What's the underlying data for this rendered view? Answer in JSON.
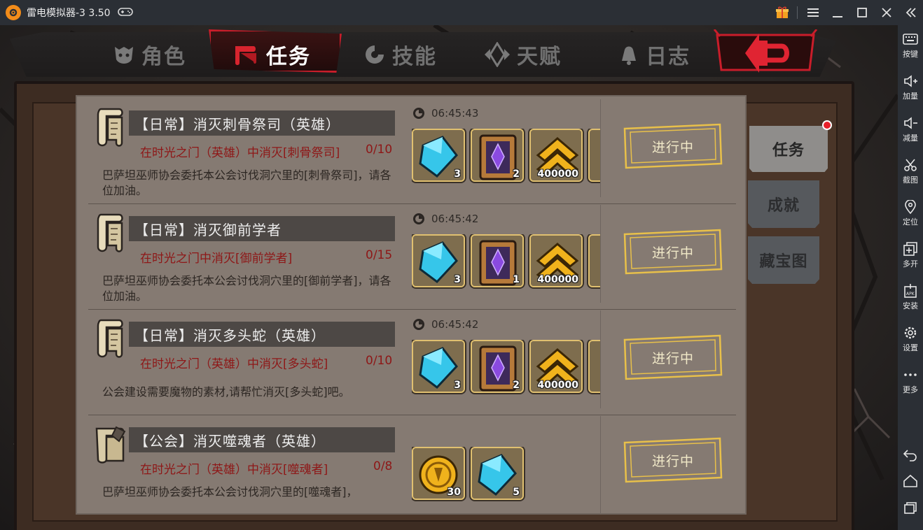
{
  "window": {
    "title": "雷电模拟器-3 3.50"
  },
  "sidebar": {
    "items": [
      {
        "label": "按键",
        "icon": "keyboard-icon"
      },
      {
        "label": "加量",
        "icon": "volume-up-icon"
      },
      {
        "label": "减量",
        "icon": "volume-down-icon"
      },
      {
        "label": "截图",
        "icon": "scissors-icon"
      },
      {
        "label": "定位",
        "icon": "location-pin-icon"
      },
      {
        "label": "多开",
        "icon": "multi-instance-icon"
      },
      {
        "label": "安装",
        "icon": "apk-install-icon"
      },
      {
        "label": "设置",
        "icon": "gear-icon"
      },
      {
        "label": "更多",
        "icon": "more-dots-icon"
      }
    ]
  },
  "tabs": [
    {
      "label": "角色",
      "icon": "character-mask-icon",
      "active": false
    },
    {
      "label": "任务",
      "icon": "quest-scroll-icon",
      "active": true
    },
    {
      "label": "技能",
      "icon": "skill-swirl-icon",
      "active": false
    },
    {
      "label": "天赋",
      "icon": "talent-crystal-icon",
      "active": false
    },
    {
      "label": "日志",
      "icon": "log-bell-icon",
      "active": false
    }
  ],
  "side_tabs": [
    {
      "label": "任务",
      "active": true
    },
    {
      "label": "成就",
      "active": false
    },
    {
      "label": "藏宝图",
      "active": false
    }
  ],
  "quests": [
    {
      "title": "【日常】消灭刺骨祭司（英雄）",
      "goal": "在时光之门（英雄）中消灭[刺骨祭司]",
      "progress": "0/10",
      "description": "巴萨坦巫师协会委托本公会讨伐洞穴里的[刺骨祭司]，请各位加油。",
      "timer": "06:45:43",
      "status": "进行中",
      "rewards": [
        {
          "icon": "blue-crystal-icon",
          "count": "3"
        },
        {
          "icon": "purple-rune-book-icon",
          "count": "2"
        },
        {
          "icon": "gold-rank-chevron-icon",
          "count": "400000"
        }
      ]
    },
    {
      "title": "【日常】消灭御前学者",
      "goal": "在时光之门中消灭[御前学者]",
      "progress": "0/15",
      "description": "巴萨坦巫师协会委托本公会讨伐洞穴里的[御前学者]，请各位加油。",
      "timer": "06:45:42",
      "status": "进行中",
      "rewards": [
        {
          "icon": "blue-crystal-icon",
          "count": "3"
        },
        {
          "icon": "purple-rune-book-icon",
          "count": "1"
        },
        {
          "icon": "gold-rank-chevron-icon",
          "count": "400000"
        }
      ]
    },
    {
      "title": "【日常】消灭多头蛇（英雄）",
      "goal": "在时光之门（英雄）中消灭[多头蛇]",
      "progress": "0/10",
      "description": "公会建设需要魔物的素材,请帮忙消灭[多头蛇]吧。",
      "timer": "06:45:42",
      "status": "进行中",
      "rewards": [
        {
          "icon": "blue-crystal-icon",
          "count": "3"
        },
        {
          "icon": "purple-rune-book-icon",
          "count": "2"
        },
        {
          "icon": "gold-rank-chevron-icon",
          "count": "400000"
        }
      ]
    },
    {
      "title": "【公会】消灭噬魂者（英雄）",
      "goal": "在时光之门（英雄）中消灭[噬魂者]",
      "progress": "0/8",
      "description": "巴萨坦巫师协会委托本公会讨伐洞穴里的[噬魂者]，",
      "timer": "",
      "status": "进行中",
      "rewards": [
        {
          "icon": "gold-guild-coin-icon",
          "count": "30"
        },
        {
          "icon": "blue-crystal-icon",
          "count": "5"
        }
      ]
    }
  ],
  "colors": {
    "accent_red": "#c91d2a",
    "goal_text": "#8e1717",
    "status_gold": "#e8c04a",
    "panel_bg": "#857a72"
  }
}
